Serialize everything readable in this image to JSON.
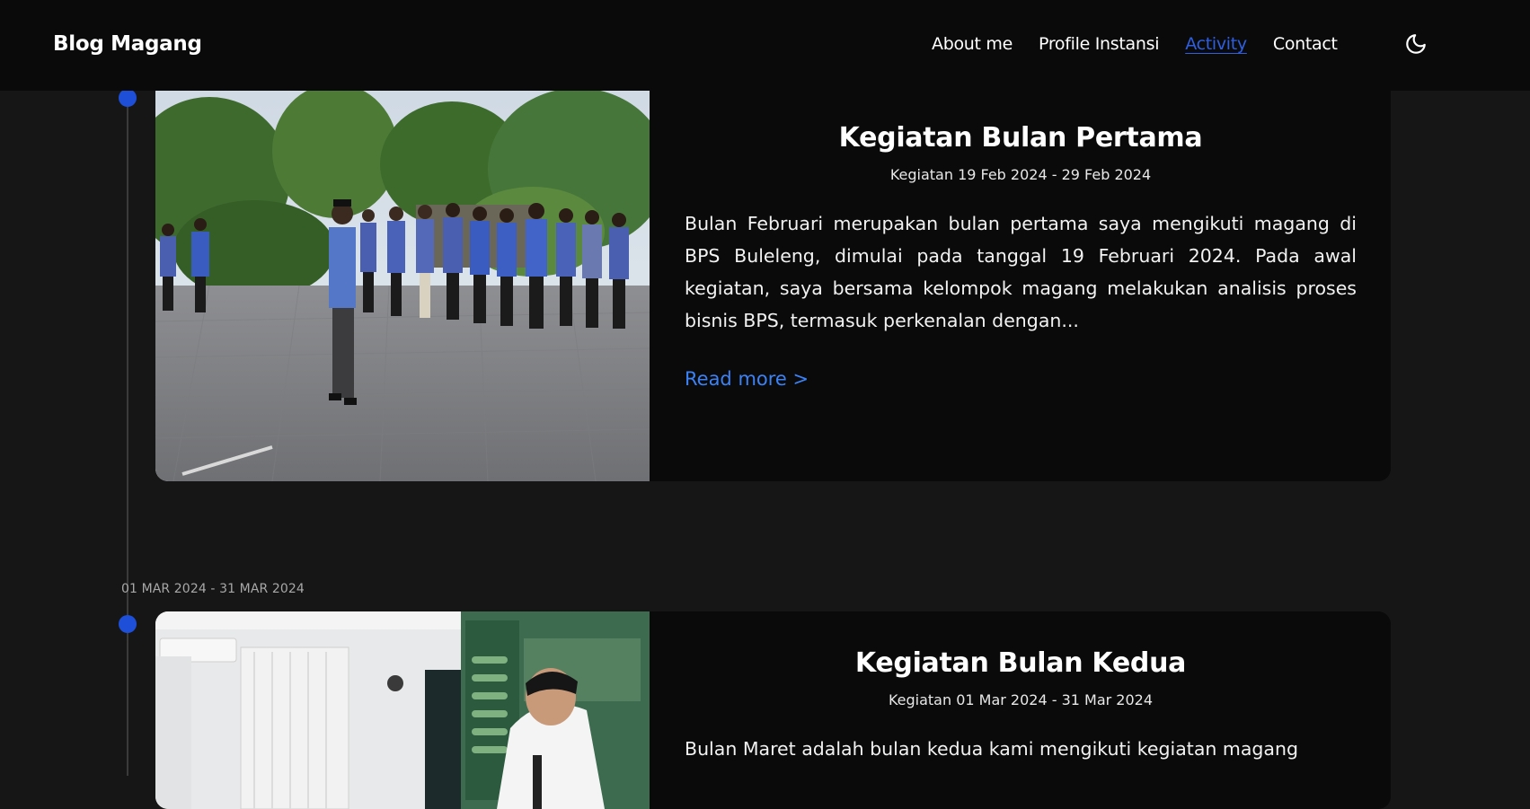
{
  "nav": {
    "brand": "Blog Magang",
    "links": [
      {
        "label": "About me",
        "active": false
      },
      {
        "label": "Profile Instansi",
        "active": false
      },
      {
        "label": "Activity",
        "active": true
      },
      {
        "label": "Contact",
        "active": false
      }
    ],
    "theme_icon": "moon-icon"
  },
  "timeline": [
    {
      "date_label": "",
      "title": "Kegiatan Bulan Pertama",
      "date": "Kegiatan 19 Feb 2024 - 29 Feb 2024",
      "description": "Bulan Februari merupakan bulan pertama saya mengikuti magang di BPS Buleleng, dimulai pada tanggal 19 Februari 2024. Pada awal kegiatan, saya bersama kelompok magang melakukan analisis proses bisnis BPS, termasuk perkenalan dengan...",
      "read_more": "Read more >"
    },
    {
      "date_label": "01 MAR 2024 - 31 MAR 2024",
      "title": "Kegiatan Bulan Kedua",
      "date": "Kegiatan 01 Mar 2024 - 31 Mar 2024",
      "description": "Bulan Maret adalah bulan kedua kami mengikuti kegiatan magang",
      "read_more": ""
    }
  ],
  "colors": {
    "accent": "#1e4fd8",
    "link": "#3b82f6",
    "active_nav": "#2f5fe0",
    "background": "#161616",
    "card": "#0a0a0a"
  }
}
